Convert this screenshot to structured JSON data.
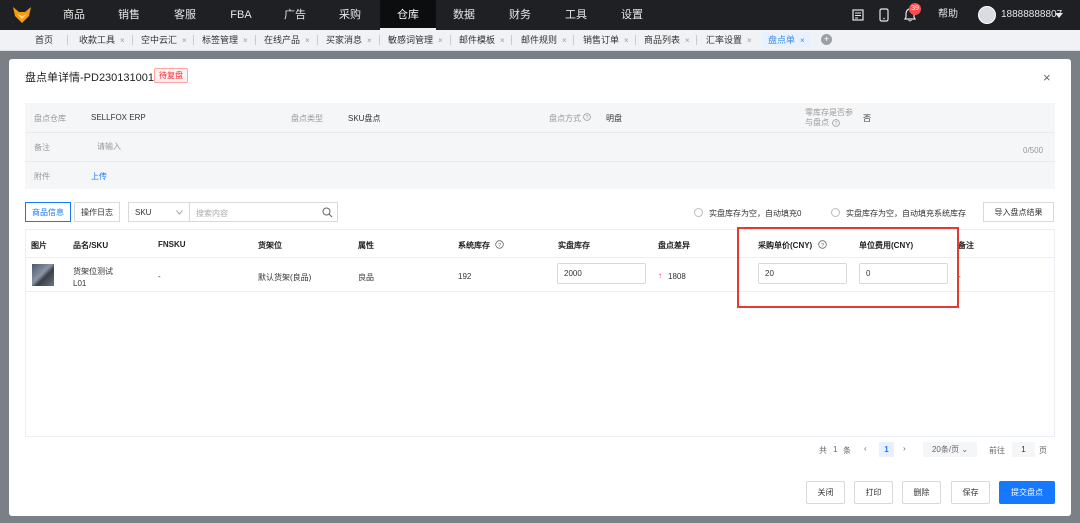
{
  "nav": {
    "items": [
      "商品",
      "销售",
      "客服",
      "FBA",
      "广告",
      "采购",
      "仓库",
      "数据",
      "财务",
      "工具",
      "设置"
    ],
    "active_index": 6,
    "help_label": "帮助",
    "notification_count": "39",
    "username": "18888888807"
  },
  "tabs": {
    "items": [
      "首页",
      "收款工具",
      "空中云汇",
      "标签管理",
      "在线产品",
      "买家消息",
      "敏感词管理",
      "邮件模板",
      "邮件规则",
      "销售订单",
      "商品列表",
      "汇率设置",
      "盘点单"
    ],
    "active_index": 12
  },
  "modal": {
    "title": "盘点单详情-PD2301310017",
    "status": "待复盘",
    "info": {
      "warehouse_label": "盘点仓库",
      "warehouse_value": "SELLFOX ERP",
      "type_label": "盘点类型",
      "type_value": "SKU盘点",
      "method_label": "盘点方式",
      "method_value": "明盘",
      "zero_stock_label": "零库存是否参与盘点",
      "zero_stock_value": "否",
      "remark_label": "备注",
      "remark_placeholder": "请输入",
      "remark_counter": "0/500",
      "attachment_label": "附件",
      "upload_link": "上传"
    },
    "toolbar": {
      "tab_product": "商品信息",
      "tab_log": "操作日志",
      "sku_select": "SKU",
      "search_placeholder": "搜索内容",
      "radio_fill_zero": "实盘库存为空，自动填充0",
      "radio_fill_system": "实盘库存为空，自动填充系统库存",
      "import_button": "导入盘点结果"
    },
    "table": {
      "headers": [
        "图片",
        "品名/SKU",
        "FNSKU",
        "货架位",
        "属性",
        "系统库存",
        "实盘库存",
        "盘点差异",
        "采购单价(CNY)",
        "单位费用(CNY)",
        "备注"
      ],
      "rows": [
        {
          "name": "货架位测试",
          "sku": "L01",
          "fnsku": "-",
          "shelf": "默认货架(良品)",
          "attribute": "良品",
          "system_stock": "192",
          "actual_stock": "2000",
          "difference": "1808",
          "unit_price": "20",
          "unit_cost": "0",
          "remark": "-"
        }
      ]
    },
    "pagination": {
      "total_prefix": "共",
      "total": "1",
      "total_suffix": "条",
      "current_page": "1",
      "page_size": "20条/页",
      "goto_prefix": "前往",
      "goto_value": "1",
      "goto_suffix": "页"
    },
    "footer": {
      "close": "关闭",
      "print": "打印",
      "delete": "删除",
      "save": "保存",
      "submit": "提交盘点"
    }
  },
  "colors": {
    "accent": "#1677ff",
    "nav_bg": "#1f2023",
    "highlight": "#e53935",
    "status": "#f5222d"
  }
}
